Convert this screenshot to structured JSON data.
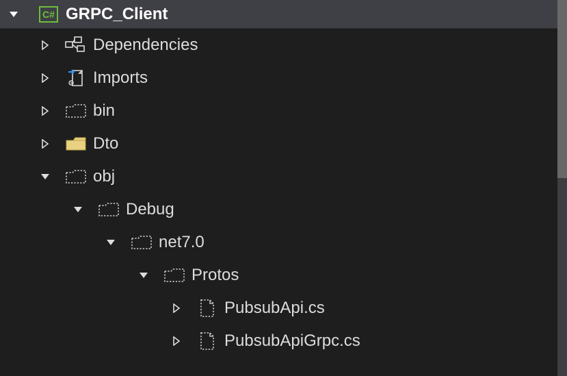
{
  "project": {
    "name": "GRPC_Client"
  },
  "nodes": {
    "dependencies": "Dependencies",
    "imports": "Imports",
    "bin": "bin",
    "dto": "Dto",
    "obj": "obj",
    "debug": "Debug",
    "net70": "net7.0",
    "protos": "Protos",
    "pubsubapi": "PubsubApi.cs",
    "pubsubapigrpc": "PubsubApiGrpc.cs"
  }
}
